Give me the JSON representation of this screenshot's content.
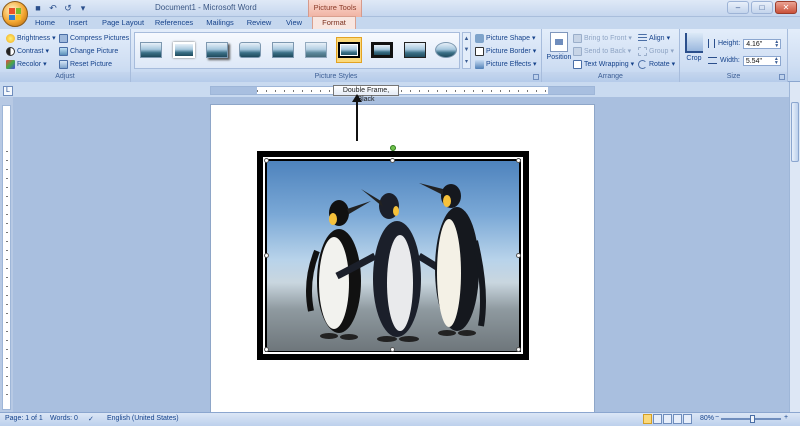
{
  "window": {
    "title": "Document1 - Microsoft Word",
    "context_tools": "Picture Tools",
    "qat_icons": [
      "save-icon",
      "undo-icon",
      "redo-icon"
    ]
  },
  "tabs": [
    {
      "label": "Home"
    },
    {
      "label": "Insert"
    },
    {
      "label": "Page Layout"
    },
    {
      "label": "References"
    },
    {
      "label": "Mailings"
    },
    {
      "label": "Review"
    },
    {
      "label": "View"
    },
    {
      "label": "Format",
      "active": true
    }
  ],
  "ribbon": {
    "adjust": {
      "label": "Adjust",
      "brightness": "Brightness",
      "contrast": "Contrast",
      "recolor": "Recolor",
      "compress": "Compress Pictures",
      "change": "Change Picture",
      "reset": "Reset Picture"
    },
    "styles": {
      "label": "Picture Styles",
      "shape": "Picture Shape",
      "border": "Picture Border",
      "effects": "Picture Effects"
    },
    "arrange": {
      "label": "Arrange",
      "position": "Position",
      "bring_front": "Bring to Front",
      "send_back": "Send to Back",
      "text_wrapping": "Text Wrapping",
      "align": "Align",
      "group": "Group",
      "rotate": "Rotate"
    },
    "size": {
      "label": "Size",
      "crop": "Crop",
      "height_label": "Height:",
      "height_value": "4.16\"",
      "width_label": "Width:",
      "width_value": "5.54\""
    }
  },
  "tooltip": "Double Frame, Black",
  "status": {
    "page": "Page: 1 of 1",
    "words": "Words: 0",
    "language": "English (United States)",
    "zoom": "80%"
  },
  "colors": {
    "ribbon_bg": "#cfdef3",
    "selected_style": "#fbd97b",
    "context_tab": "#f0b3a3",
    "frame": "#000000"
  }
}
